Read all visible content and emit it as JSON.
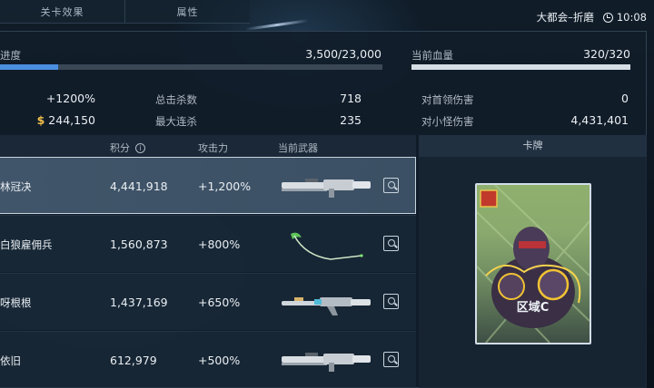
{
  "tabs": [
    "关卡效果",
    "属性"
  ],
  "status": {
    "location": "大都会–折磨",
    "time": "10:08"
  },
  "progress": {
    "label": "进度",
    "value": "3,500/23,000",
    "fraction": 0.152
  },
  "hp": {
    "label": "当前血量",
    "value": "320/320",
    "fraction": 1.0
  },
  "stats_left": {
    "bonus": "+1200%",
    "money": "244,150",
    "coin_icon": "$"
  },
  "stats_mid": [
    {
      "label": "总击杀数",
      "value": "718"
    },
    {
      "label": "最大连杀",
      "value": "235"
    }
  ],
  "stats_right": [
    {
      "label": "对首领伤害",
      "value": "0"
    },
    {
      "label": "对小怪伤害",
      "value": "4,431,401"
    }
  ],
  "table": {
    "headers": {
      "score": "积分",
      "atk": "攻击力",
      "weapon": "当前武器",
      "info_icon": "i"
    },
    "rows": [
      {
        "name": "林冠决",
        "score": "4,441,918",
        "atk": "+1,200%",
        "weapon": "gatling-rifle",
        "selected": true
      },
      {
        "name": "白狼雇佣兵",
        "score": "1,560,873",
        "atk": "+800%",
        "weapon": "green-scythe",
        "selected": false
      },
      {
        "name": "呀根根",
        "score": "1,437,169",
        "atk": "+650%",
        "weapon": "ornate-rifle",
        "selected": false
      },
      {
        "name": "依旧",
        "score": "612,979",
        "atk": "+500%",
        "weapon": "gatling-rifle",
        "selected": false
      }
    ]
  },
  "card": {
    "header": "卡牌",
    "zone": "区域C"
  },
  "colors": {
    "progress_fill": "#4a8fe0",
    "hp_fill": "#d5dee5",
    "accent": "#f1c04b"
  }
}
